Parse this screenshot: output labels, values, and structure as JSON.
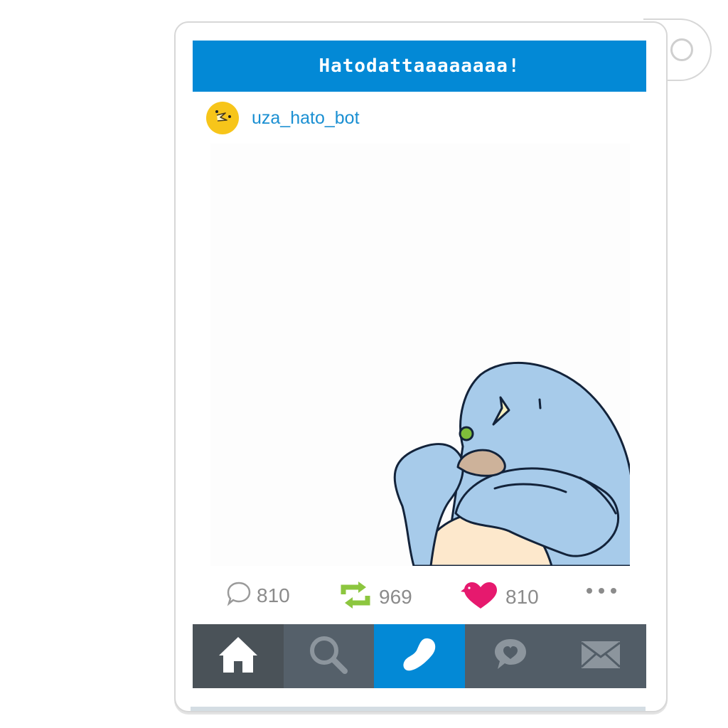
{
  "header": {
    "title": "Hatodattaaaaaaaa!"
  },
  "post": {
    "username": "uza_hato_bot",
    "avatar_icon": "pigeon-face-icon",
    "image_subject": "blue-pigeon-illustration"
  },
  "actions": {
    "reply": {
      "icon": "reply-bubble-icon",
      "count": "810",
      "color": "#9a9a9a"
    },
    "repost": {
      "icon": "repost-icon",
      "count": "969",
      "color": "#8cc63f"
    },
    "like": {
      "icon": "heart-bird-icon",
      "count": "810",
      "color": "#e6196e"
    },
    "more": {
      "icon": "more-dots-icon"
    }
  },
  "nav": {
    "items": [
      {
        "icon": "home-icon",
        "bg": "#4a5258",
        "active": false
      },
      {
        "icon": "search-icon",
        "bg": "#55606a",
        "active": false
      },
      {
        "icon": "bean-icon",
        "bg": "#0389d6",
        "active": true
      },
      {
        "icon": "message-heart-icon",
        "bg": "#525d67",
        "active": false
      },
      {
        "icon": "mail-icon",
        "bg": "#525d67",
        "active": false
      }
    ]
  },
  "colors": {
    "accent": "#0389d6",
    "link": "#1a8fd2",
    "avatar": "#f7c51a",
    "pigeon": "#a7cbea"
  }
}
